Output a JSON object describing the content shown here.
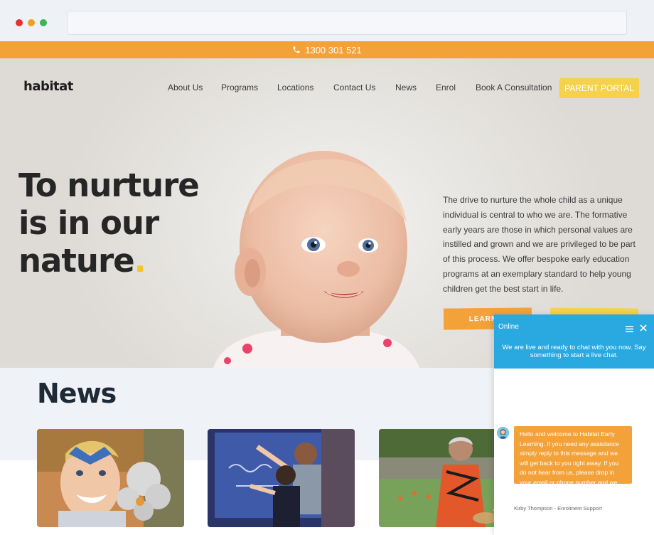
{
  "topbar": {
    "phone": "1300 301 521"
  },
  "header": {
    "logo": "habitat",
    "nav": [
      "About Us",
      "Programs",
      "Locations",
      "Contact Us",
      "News",
      "Enrol",
      "Book A Consultation"
    ],
    "portal_label": "PARENT PORTAL"
  },
  "hero": {
    "headline": [
      "To nurture",
      "is in our",
      "nature"
    ],
    "headline_period": ".",
    "description": "The drive to nurture the whole child as a unique individual is central to who we are. The formative early years are those in which personal values are instilled and grown and we are privileged to be part of this process. We offer bespoke early education programs at an exemplary standard to help young children get the best start in life.",
    "learn_more_label": "LEARN M"
  },
  "news": {
    "title": "News"
  },
  "chat": {
    "status": "Online",
    "intro": "We are live and ready to chat with you now. Say something to start a live chat.",
    "message": "Hello and welcome to Habitat Early Learning. If you need any assistance simply reply to this message and we will get back to you right away. If you do not hear from us, please drop in your email or phone number and we will get back to you ASAP.",
    "agent": "Kirby Thompson - Enrolment Support"
  },
  "colors": {
    "orange": "#f3a23a",
    "yellow": "#f5d24a",
    "chat_blue": "#2aa9e0",
    "dark": "#262626"
  }
}
